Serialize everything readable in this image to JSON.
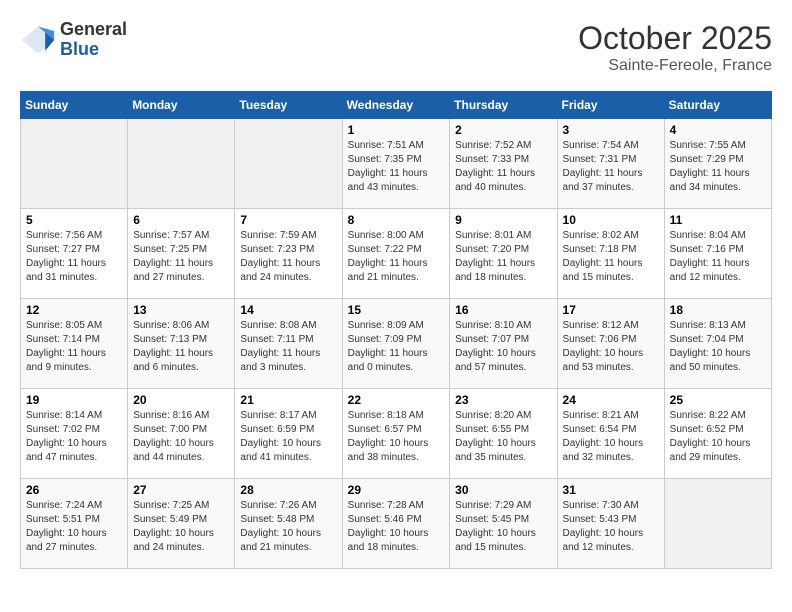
{
  "header": {
    "logo_general": "General",
    "logo_blue": "Blue",
    "month": "October 2025",
    "location": "Sainte-Fereole, France"
  },
  "weekdays": [
    "Sunday",
    "Monday",
    "Tuesday",
    "Wednesday",
    "Thursday",
    "Friday",
    "Saturday"
  ],
  "weeks": [
    [
      {
        "day": "",
        "info": ""
      },
      {
        "day": "",
        "info": ""
      },
      {
        "day": "",
        "info": ""
      },
      {
        "day": "1",
        "info": "Sunrise: 7:51 AM\nSunset: 7:35 PM\nDaylight: 11 hours and 43 minutes."
      },
      {
        "day": "2",
        "info": "Sunrise: 7:52 AM\nSunset: 7:33 PM\nDaylight: 11 hours and 40 minutes."
      },
      {
        "day": "3",
        "info": "Sunrise: 7:54 AM\nSunset: 7:31 PM\nDaylight: 11 hours and 37 minutes."
      },
      {
        "day": "4",
        "info": "Sunrise: 7:55 AM\nSunset: 7:29 PM\nDaylight: 11 hours and 34 minutes."
      }
    ],
    [
      {
        "day": "5",
        "info": "Sunrise: 7:56 AM\nSunset: 7:27 PM\nDaylight: 11 hours and 31 minutes."
      },
      {
        "day": "6",
        "info": "Sunrise: 7:57 AM\nSunset: 7:25 PM\nDaylight: 11 hours and 27 minutes."
      },
      {
        "day": "7",
        "info": "Sunrise: 7:59 AM\nSunset: 7:23 PM\nDaylight: 11 hours and 24 minutes."
      },
      {
        "day": "8",
        "info": "Sunrise: 8:00 AM\nSunset: 7:22 PM\nDaylight: 11 hours and 21 minutes."
      },
      {
        "day": "9",
        "info": "Sunrise: 8:01 AM\nSunset: 7:20 PM\nDaylight: 11 hours and 18 minutes."
      },
      {
        "day": "10",
        "info": "Sunrise: 8:02 AM\nSunset: 7:18 PM\nDaylight: 11 hours and 15 minutes."
      },
      {
        "day": "11",
        "info": "Sunrise: 8:04 AM\nSunset: 7:16 PM\nDaylight: 11 hours and 12 minutes."
      }
    ],
    [
      {
        "day": "12",
        "info": "Sunrise: 8:05 AM\nSunset: 7:14 PM\nDaylight: 11 hours and 9 minutes."
      },
      {
        "day": "13",
        "info": "Sunrise: 8:06 AM\nSunset: 7:13 PM\nDaylight: 11 hours and 6 minutes."
      },
      {
        "day": "14",
        "info": "Sunrise: 8:08 AM\nSunset: 7:11 PM\nDaylight: 11 hours and 3 minutes."
      },
      {
        "day": "15",
        "info": "Sunrise: 8:09 AM\nSunset: 7:09 PM\nDaylight: 11 hours and 0 minutes."
      },
      {
        "day": "16",
        "info": "Sunrise: 8:10 AM\nSunset: 7:07 PM\nDaylight: 10 hours and 57 minutes."
      },
      {
        "day": "17",
        "info": "Sunrise: 8:12 AM\nSunset: 7:06 PM\nDaylight: 10 hours and 53 minutes."
      },
      {
        "day": "18",
        "info": "Sunrise: 8:13 AM\nSunset: 7:04 PM\nDaylight: 10 hours and 50 minutes."
      }
    ],
    [
      {
        "day": "19",
        "info": "Sunrise: 8:14 AM\nSunset: 7:02 PM\nDaylight: 10 hours and 47 minutes."
      },
      {
        "day": "20",
        "info": "Sunrise: 8:16 AM\nSunset: 7:00 PM\nDaylight: 10 hours and 44 minutes."
      },
      {
        "day": "21",
        "info": "Sunrise: 8:17 AM\nSunset: 6:59 PM\nDaylight: 10 hours and 41 minutes."
      },
      {
        "day": "22",
        "info": "Sunrise: 8:18 AM\nSunset: 6:57 PM\nDaylight: 10 hours and 38 minutes."
      },
      {
        "day": "23",
        "info": "Sunrise: 8:20 AM\nSunset: 6:55 PM\nDaylight: 10 hours and 35 minutes."
      },
      {
        "day": "24",
        "info": "Sunrise: 8:21 AM\nSunset: 6:54 PM\nDaylight: 10 hours and 32 minutes."
      },
      {
        "day": "25",
        "info": "Sunrise: 8:22 AM\nSunset: 6:52 PM\nDaylight: 10 hours and 29 minutes."
      }
    ],
    [
      {
        "day": "26",
        "info": "Sunrise: 7:24 AM\nSunset: 5:51 PM\nDaylight: 10 hours and 27 minutes."
      },
      {
        "day": "27",
        "info": "Sunrise: 7:25 AM\nSunset: 5:49 PM\nDaylight: 10 hours and 24 minutes."
      },
      {
        "day": "28",
        "info": "Sunrise: 7:26 AM\nSunset: 5:48 PM\nDaylight: 10 hours and 21 minutes."
      },
      {
        "day": "29",
        "info": "Sunrise: 7:28 AM\nSunset: 5:46 PM\nDaylight: 10 hours and 18 minutes."
      },
      {
        "day": "30",
        "info": "Sunrise: 7:29 AM\nSunset: 5:45 PM\nDaylight: 10 hours and 15 minutes."
      },
      {
        "day": "31",
        "info": "Sunrise: 7:30 AM\nSunset: 5:43 PM\nDaylight: 10 hours and 12 minutes."
      },
      {
        "day": "",
        "info": ""
      }
    ]
  ]
}
